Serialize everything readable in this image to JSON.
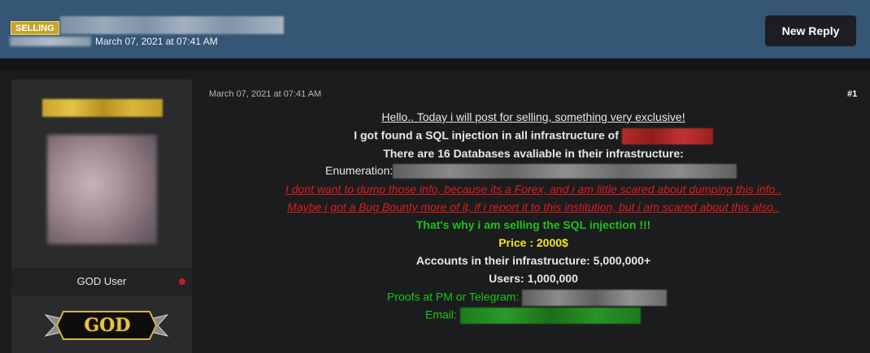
{
  "header": {
    "badge": "SELLING",
    "date": "March 07, 2021 at 07:41 AM",
    "new_reply": "New Reply"
  },
  "sidebar": {
    "rank": "GOD User",
    "emblem": "GOD"
  },
  "post": {
    "date": "March 07, 2021 at 07:41 AM",
    "number": "#1",
    "lines": {
      "l1": "Hello.. Today i will post for selling, something very exclusive!",
      "l2": "I got found a SQL injection in all infrastructure of",
      "l3": "There are 16 Databases avaliable in their infrastructure:",
      "l4": "Enumeration:",
      "l5": "I dont want to dump those info, because its a Forex, and i am little scared about dumping this info..",
      "l6": "Maybe i got a Bug Bounty more of it, if i report it to this institution, but i am scared about this also..",
      "l7": "That's why i am selling the SQL injection !!!",
      "l8": "Price : 2000$",
      "l9": "Accounts in their infrastructure: 5,000,000+",
      "l10": "Users: 1,000,000",
      "l11": "Proofs at PM or Telegram:",
      "l12": "Email:"
    }
  },
  "colors": {
    "header_bg": "#355675",
    "badge_bg": "#c9a42c",
    "text_red": "#e01b1b",
    "text_green": "#19c419",
    "text_yellow": "#f5e51f"
  }
}
